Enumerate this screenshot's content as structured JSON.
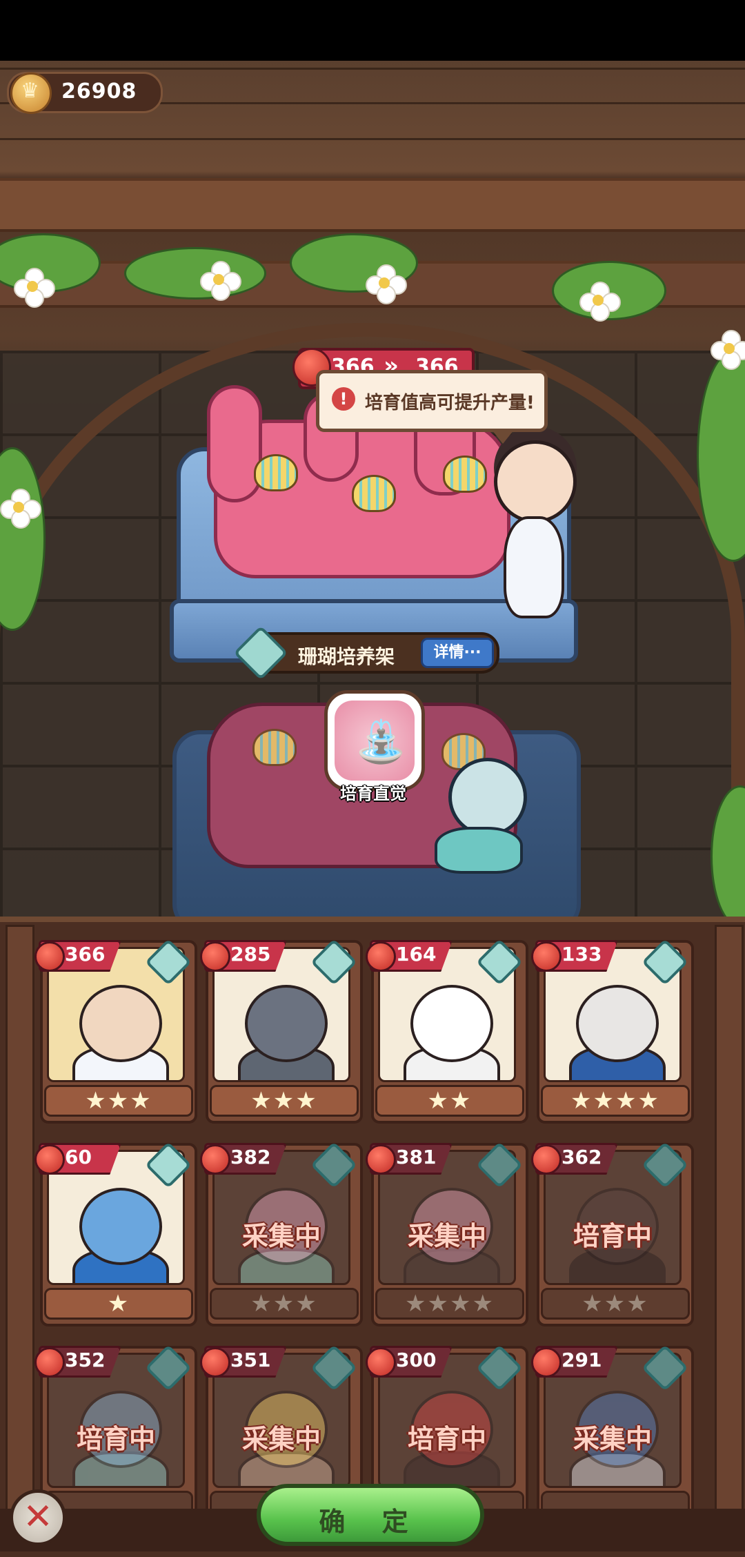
{
  "currency": {
    "value": "26908"
  },
  "shelf": {
    "output_from": "366",
    "output_to": "366",
    "tip": "培育值高可提升产量!",
    "tip_icon": "!",
    "title": "珊瑚培养架",
    "detail_button": "详情···"
  },
  "skill": {
    "label": "培育直觉",
    "icon": "watering-can-icon"
  },
  "cards": [
    {
      "value": "366",
      "stars": "★★★",
      "status": ""
    },
    {
      "value": "285",
      "stars": "★★★",
      "status": ""
    },
    {
      "value": "164",
      "stars": "★★",
      "status": ""
    },
    {
      "value": "133",
      "stars": "★★★★",
      "status": ""
    },
    {
      "value": "60",
      "stars": "★",
      "status": ""
    },
    {
      "value": "382",
      "stars": "★★★",
      "status": "采集中"
    },
    {
      "value": "381",
      "stars": "★★★★",
      "status": "采集中"
    },
    {
      "value": "362",
      "stars": "★★★",
      "status": "培育中"
    },
    {
      "value": "352",
      "stars": "",
      "status": "培育中"
    },
    {
      "value": "351",
      "stars": "",
      "status": "采集中"
    },
    {
      "value": "300",
      "stars": "",
      "status": "培育中"
    },
    {
      "value": "291",
      "stars": "",
      "status": "采集中"
    }
  ],
  "buttons": {
    "confirm": "确 定",
    "close": "✕"
  },
  "colors": {
    "accent_red": "#c8344a",
    "confirm_green": "#58c24c",
    "coral_pink": "#e96a8d"
  }
}
